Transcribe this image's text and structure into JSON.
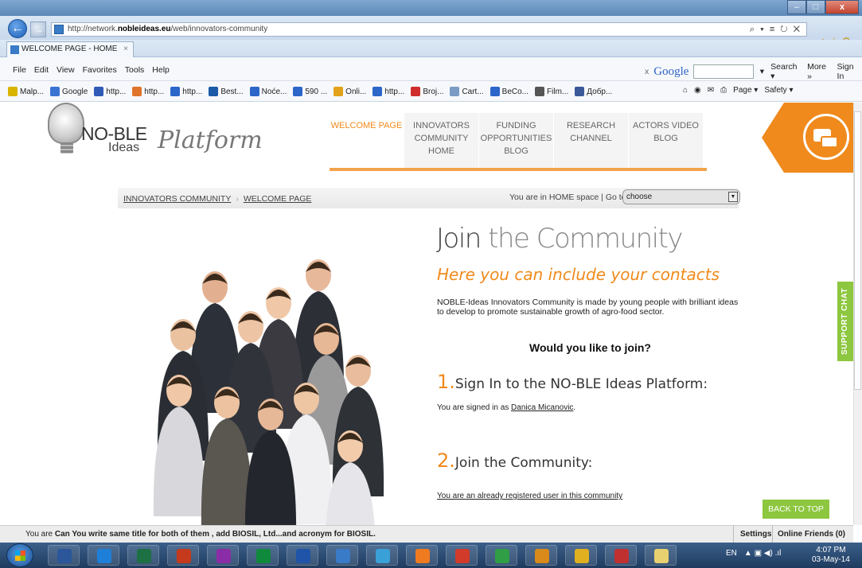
{
  "browser": {
    "url_prefix": "http://network.",
    "url_domain": "nobleideas.eu",
    "url_path": "/web/innovators-community",
    "url_tools": "⌕ ▾ ≡ ↻ ✕",
    "tab_title": "WELCOME PAGE - HOME",
    "tab_close": "×",
    "window_controls": {
      "minimize": "–",
      "maximize": "□",
      "close": "x"
    },
    "menu": [
      "File",
      "Edit",
      "View",
      "Favorites",
      "Tools",
      "Help"
    ],
    "google_toolbar": {
      "close": "x",
      "logo": "Google",
      "search": "Search ▾",
      "more": "More »",
      "signin": "Sign In"
    },
    "favorites": [
      {
        "label": "Malp...",
        "color": "#d9b400"
      },
      {
        "label": "Google",
        "color": "#3b73d3"
      },
      {
        "label": "http...",
        "color": "#2f5bb7"
      },
      {
        "label": "http...",
        "color": "#e0742a"
      },
      {
        "label": "http...",
        "color": "#2d66c9"
      },
      {
        "label": "Best...",
        "color": "#1b5aa6"
      },
      {
        "label": "Noće...",
        "color": "#2d66c9"
      },
      {
        "label": "590 ...",
        "color": "#2d66c9"
      },
      {
        "label": "Onli...",
        "color": "#e2a21a"
      },
      {
        "label": "http...",
        "color": "#2d66c9"
      },
      {
        "label": "Broj...",
        "color": "#d12c2c"
      },
      {
        "label": "Cart...",
        "color": "#7a9bc4"
      },
      {
        "label": "BeCo...",
        "color": "#2d66c9"
      },
      {
        "label": "Film...",
        "color": "#555555"
      },
      {
        "label": "Добр...",
        "color": "#3b5998"
      }
    ],
    "command_bar": {
      "page": "Page ▾",
      "safety": "Safety ▾"
    }
  },
  "site": {
    "logo": {
      "noble": "NO-BLE",
      "ideas": "Ideas",
      "platform": "Platform"
    },
    "nav": [
      {
        "label": "WELCOME PAGE",
        "active": true
      },
      {
        "label": "INNOVATORS COMMUNITY HOME",
        "active": false
      },
      {
        "label": "FUNDING OPPORTUNITIES BLOG",
        "active": false
      },
      {
        "label": "RESEARCH CHANNEL",
        "active": false
      },
      {
        "label": "ACTORS VIDEO BLOG",
        "active": false
      }
    ],
    "breadcrumb": {
      "community": "INNOVATORS COMMUNITY",
      "sep": "›",
      "page": "WELCOME PAGE"
    },
    "space_text": "You are in HOME space | Go to",
    "space_select": "choose",
    "join": {
      "title_a": "Join",
      "title_b": "the Community",
      "subtitle": "Here you can include your contacts",
      "description": "NOBLE-Ideas Innovators Community is made by young people with brilliant ideas to develop to promote sustainable growth of agro-food sector.",
      "question": "Would you like to join?",
      "step1_num": "1.",
      "step1_label": "Sign In to the NO-BLE Ideas Platform:",
      "step1_text": "You are signed in as",
      "step1_user": "Danica Micanovic",
      "step1_end": ".",
      "step2_num": "2.",
      "step2_label": "Join the Community:",
      "step2_text": "You are an already registered user in this community"
    },
    "support_chat": "SUPPORT CHAT",
    "back_to_top": "BACK TO TOP"
  },
  "status": {
    "prefix": "You are",
    "message": "Can You write same title for both of them , add BIOSIL, Ltd...and acronym for BIOSIL.",
    "settings": "Settings",
    "friends": "Online Friends (0)"
  },
  "taskbar": {
    "lang": "EN",
    "tray": "▲ ▣ ◀) .ıl",
    "time": "4:07 PM",
    "date": "03-May-14",
    "apps": [
      "#2b579a",
      "#1e7fd8",
      "#1d7044",
      "#c5391c",
      "#8a2da6",
      "#0f8a3c",
      "#1f54a8",
      "#3a7bc8",
      "#3aa0d8",
      "#f07a20",
      "#d23a2a",
      "#2f9e44",
      "#d98a1a",
      "#e0b020",
      "#c03030",
      "#e8d070"
    ]
  }
}
